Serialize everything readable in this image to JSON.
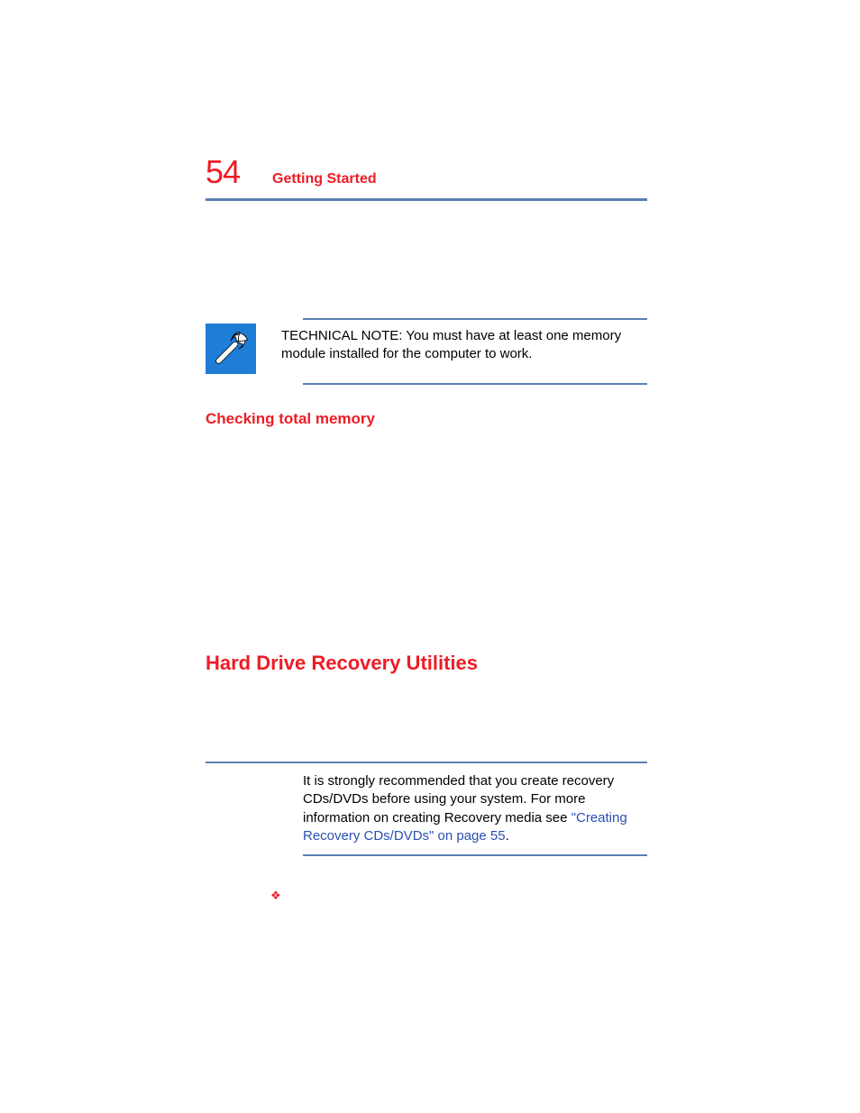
{
  "header": {
    "page_number": "54",
    "chapter_title": "Getting Started"
  },
  "technical_note": {
    "text": "TECHNICAL NOTE: You must have at least one memory module installed for the computer to work."
  },
  "subsection": {
    "title": "Checking total memory"
  },
  "section": {
    "title": "Hard Drive Recovery Utilities"
  },
  "recommendation_note": {
    "prefix": "It is strongly recommended that you create recovery CDs/DVDs before using your system. For more information on creating Recovery media see ",
    "link": "\"Creating Recovery CDs/DVDs\" on page 55",
    "suffix": "."
  },
  "bullet": {
    "glyph": "❖"
  }
}
